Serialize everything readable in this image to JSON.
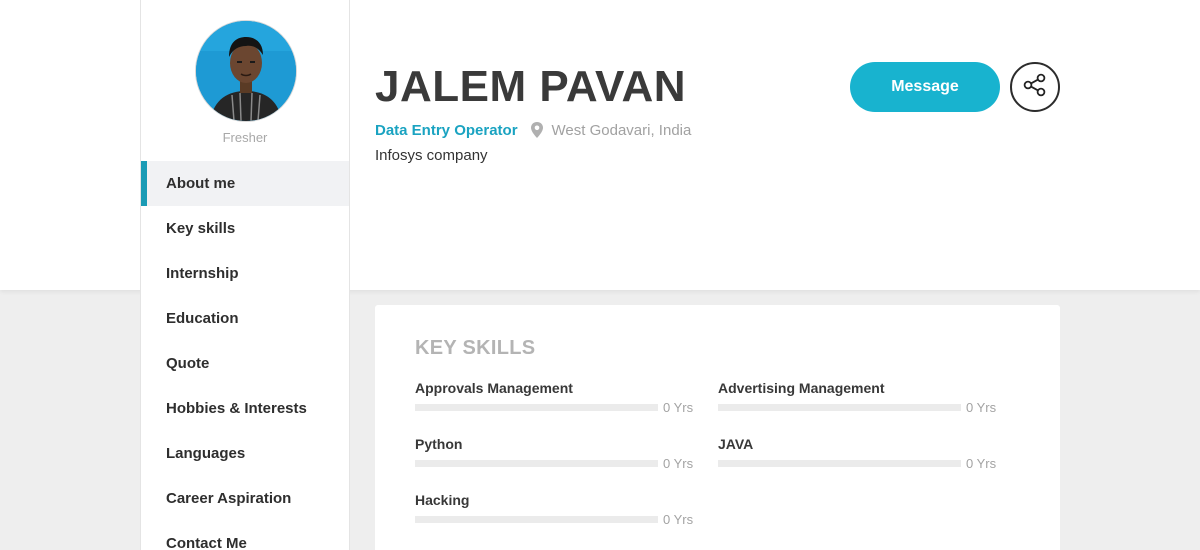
{
  "profile": {
    "name": "JALEM PAVAN",
    "role": "Data Entry Operator",
    "location": "West Godavari, India",
    "company": "Infosys company",
    "status": "Fresher"
  },
  "actions": {
    "message_label": "Message",
    "share_icon": "share-icon"
  },
  "sidebar": {
    "items": [
      {
        "label": "About me",
        "active": true
      },
      {
        "label": "Key skills"
      },
      {
        "label": "Internship"
      },
      {
        "label": "Education"
      },
      {
        "label": "Quote"
      },
      {
        "label": "Hobbies & Interests"
      },
      {
        "label": "Languages"
      },
      {
        "label": "Career Aspiration"
      },
      {
        "label": "Contact Me"
      }
    ]
  },
  "key_skills": {
    "title": "KEY SKILLS",
    "skills": [
      {
        "name": "Approvals Management",
        "years": "0 Yrs",
        "level": 0
      },
      {
        "name": "Advertising Management",
        "years": "0 Yrs",
        "level": 0
      },
      {
        "name": "Python",
        "years": "0 Yrs",
        "level": 0
      },
      {
        "name": "JAVA",
        "years": "0 Yrs",
        "level": 0
      },
      {
        "name": "Hacking",
        "years": "0 Yrs",
        "level": 0
      }
    ]
  },
  "colors": {
    "accent": "#18b3cf",
    "active_marker": "#1a9bb5",
    "role_text": "#1aa3c1"
  }
}
